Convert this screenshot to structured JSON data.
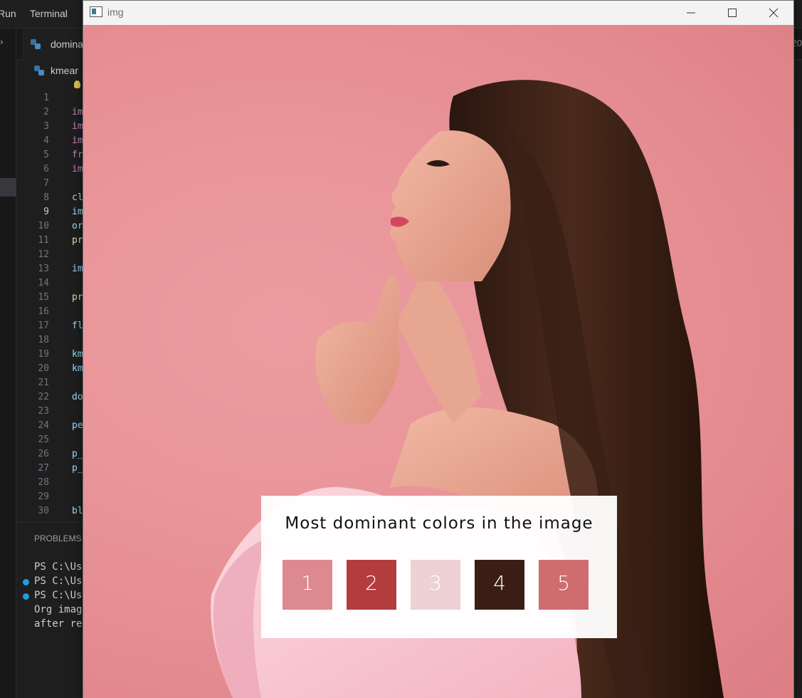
{
  "vscode": {
    "menu": [
      "Run",
      "Terminal"
    ],
    "tabs": [
      {
        "label": "domina"
      }
    ],
    "right_tab_fragment": "20",
    "breadcrumb": "kmear",
    "line_numbers": [
      "1",
      "2",
      "3",
      "4",
      "5",
      "6",
      "7",
      "8",
      "9",
      "10",
      "11",
      "12",
      "13",
      "14",
      "15",
      "16",
      "17",
      "18",
      "19",
      "20",
      "21",
      "22",
      "23",
      "24",
      "25",
      "26",
      "27",
      "28",
      "29",
      "30"
    ],
    "active_line": "9",
    "code_lines": [
      {
        "line": 2,
        "text": "im",
        "color": "#c586c0"
      },
      {
        "line": 3,
        "text": "im",
        "color": "#c586c0"
      },
      {
        "line": 4,
        "text": "im",
        "color": "#c586c0"
      },
      {
        "line": 5,
        "text": "fr",
        "color": "#c586c0"
      },
      {
        "line": 6,
        "text": "im",
        "color": "#c586c0"
      },
      {
        "line": 8,
        "text": "cl",
        "color": "#9cdcfe"
      },
      {
        "line": 9,
        "text": "im",
        "color": "#9cdcfe"
      },
      {
        "line": 10,
        "text": "or",
        "color": "#9cdcfe"
      },
      {
        "line": 11,
        "text": "pr",
        "color": "#dcdcaa"
      },
      {
        "line": 13,
        "text": "im",
        "color": "#9cdcfe"
      },
      {
        "line": 15,
        "text": "pr",
        "color": "#dcdcaa"
      },
      {
        "line": 17,
        "text": "fl",
        "color": "#9cdcfe"
      },
      {
        "line": 19,
        "text": "km",
        "color": "#9cdcfe"
      },
      {
        "line": 20,
        "text": "km",
        "color": "#9cdcfe"
      },
      {
        "line": 22,
        "text": "do",
        "color": "#9cdcfe"
      },
      {
        "line": 24,
        "text": "pe",
        "color": "#9cdcfe"
      },
      {
        "line": 26,
        "text": "p_",
        "color": "#9cdcfe"
      },
      {
        "line": 27,
        "text": "p_",
        "color": "#9cdcfe"
      },
      {
        "line": 30,
        "text": "bl",
        "color": "#9cdcfe"
      }
    ],
    "panel_tab": "PROBLEMS",
    "terminal_lines": [
      {
        "text": "PS C:\\Us",
        "dot": false
      },
      {
        "text": "PS C:\\Us",
        "dot": true
      },
      {
        "text": "PS C:\\Us",
        "dot": true
      },
      {
        "text": "Org imag",
        "dot": false
      },
      {
        "text": "after re",
        "dot": false
      }
    ]
  },
  "window": {
    "title": "img",
    "controls": {
      "minimize": "minimize-icon",
      "maximize": "maximize-icon",
      "close": "close-icon"
    }
  },
  "overlay": {
    "title": "Most dominant colors in the image",
    "swatches": [
      {
        "label": "1",
        "color": "#dc8a8f"
      },
      {
        "label": "2",
        "color": "#b23c3e"
      },
      {
        "label": "3",
        "color": "#edd1d4"
      },
      {
        "label": "4",
        "color": "#3a1d15"
      },
      {
        "label": "5",
        "color": "#cf6c70"
      }
    ]
  }
}
